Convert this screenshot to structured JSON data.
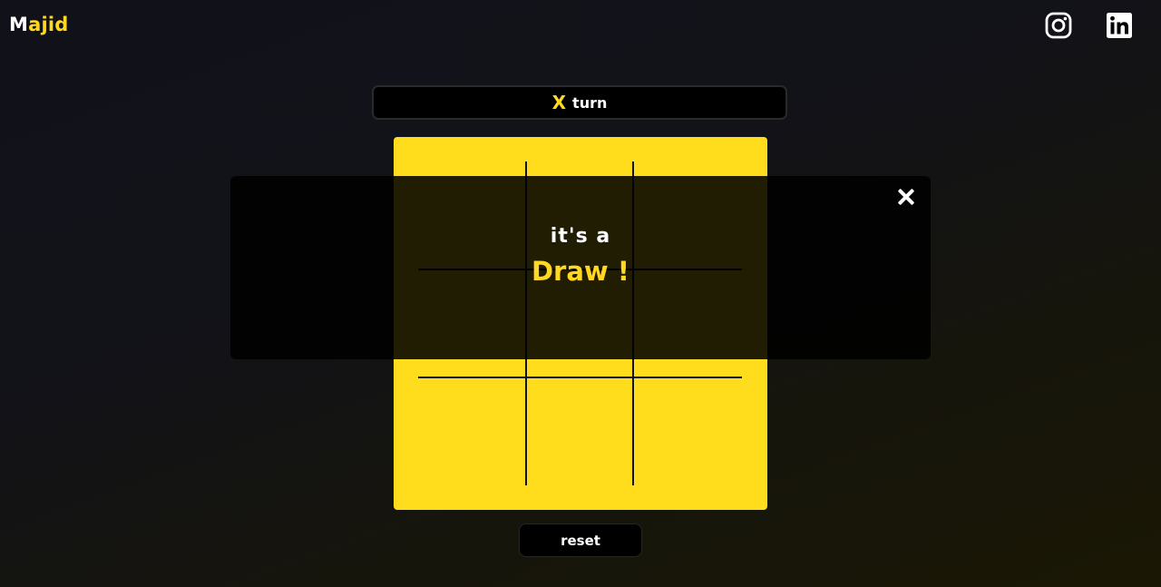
{
  "header": {
    "logo_first": "M",
    "logo_rest": "ajid",
    "social": [
      {
        "name": "instagram",
        "icon": "instagram-icon"
      },
      {
        "name": "linkedin",
        "icon": "linkedin-icon"
      }
    ]
  },
  "status": {
    "player": "X",
    "label": "turn"
  },
  "board": {
    "cells": [
      "",
      "",
      "",
      "",
      "",
      "",
      "",
      "",
      ""
    ]
  },
  "controls": {
    "reset_label": "reset"
  },
  "modal": {
    "line1": "it's a",
    "line2": "Draw !",
    "close_icon": "close-icon"
  },
  "colors": {
    "accent": "#ffd81f",
    "board": "#ffdd1c",
    "background": "#121219",
    "panel": "#000000"
  }
}
